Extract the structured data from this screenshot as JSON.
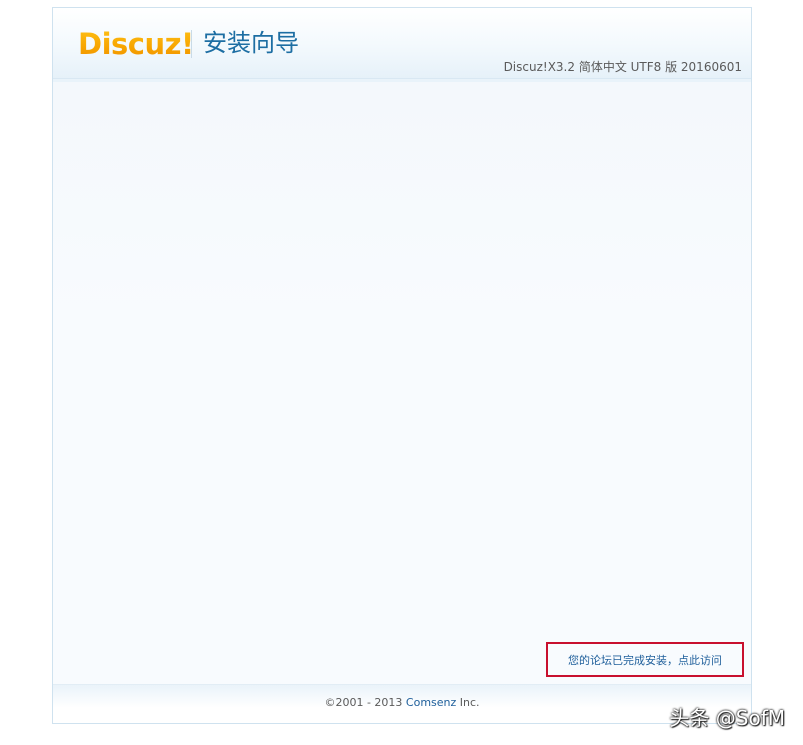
{
  "header": {
    "logo_text": "Discuz!",
    "wizard_title": "安装向导",
    "version": "Discuz!X3.2 简体中文 UTF8 版 20160601"
  },
  "content": {
    "complete_link_text": "您的论坛已完成安装，点此访问",
    "highlight_color": "#c8102e"
  },
  "footer": {
    "copyright_prefix": "©2001 - 2013",
    "company_link": "Comsenz",
    "copyright_suffix": "Inc."
  },
  "watermark": {
    "text": "头条 @SofM"
  },
  "colors": {
    "brand_orange": "#f7a400",
    "title_blue": "#1d6ea3",
    "link_blue": "#1f5f9b"
  }
}
